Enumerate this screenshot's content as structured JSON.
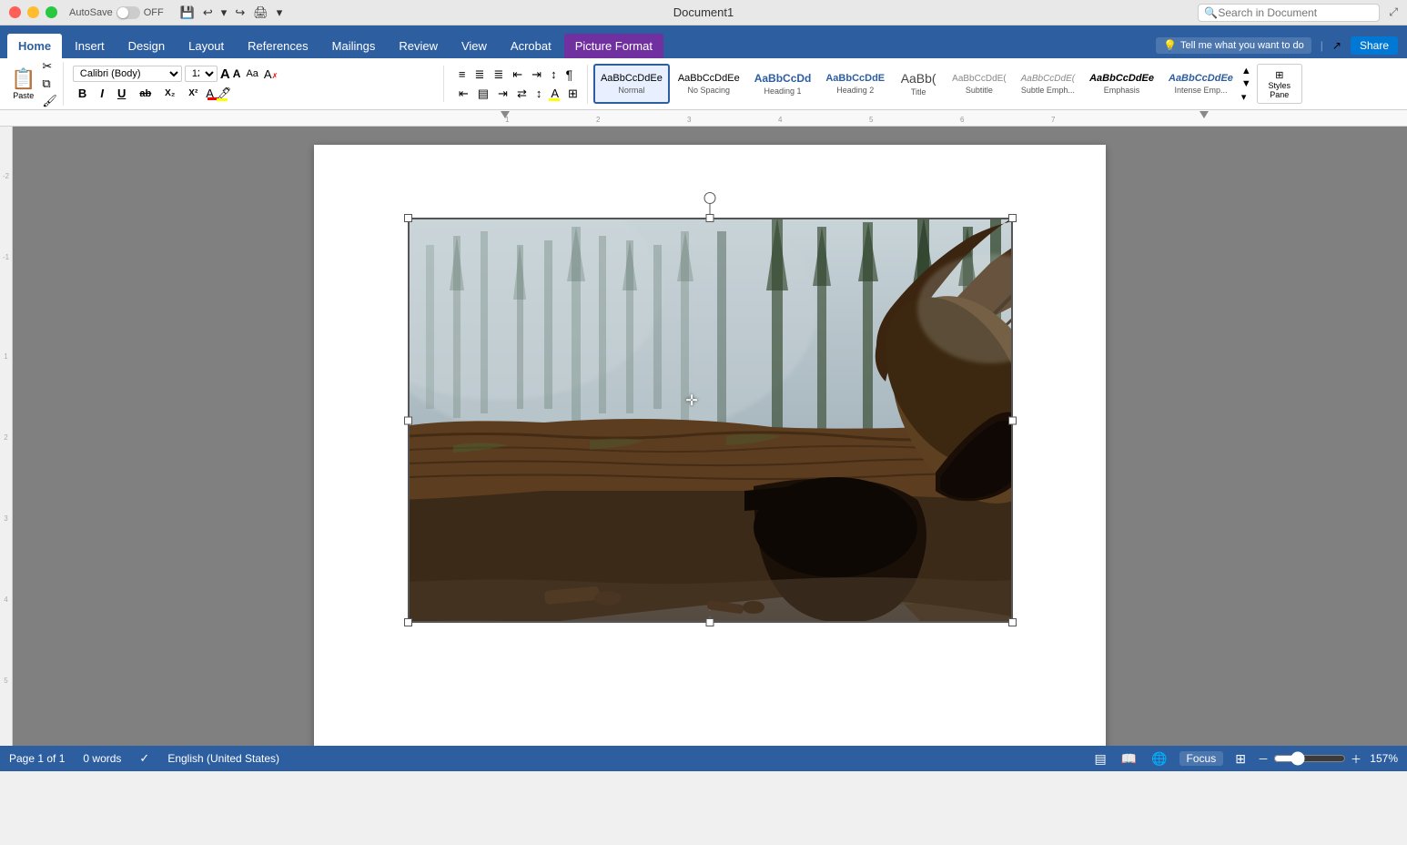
{
  "titleBar": {
    "title": "Document1",
    "autosave": "AutoSave",
    "autosave_off": "OFF",
    "search_placeholder": "Search in Document"
  },
  "ribbonTabs": {
    "tabs": [
      {
        "id": "home",
        "label": "Home",
        "active": true
      },
      {
        "id": "insert",
        "label": "Insert"
      },
      {
        "id": "design",
        "label": "Design"
      },
      {
        "id": "layout",
        "label": "Layout"
      },
      {
        "id": "references",
        "label": "References"
      },
      {
        "id": "mailings",
        "label": "Mailings"
      },
      {
        "id": "review",
        "label": "Review"
      },
      {
        "id": "view",
        "label": "View"
      },
      {
        "id": "acrobat",
        "label": "Acrobat"
      },
      {
        "id": "picture_format",
        "label": "Picture Format",
        "special": true
      }
    ],
    "tell_me": "Tell me what you want to do",
    "share": "Share"
  },
  "fontControls": {
    "font": "Calibri (Body)",
    "size": "12",
    "bold": "B",
    "italic": "I",
    "underline": "U",
    "strikethrough": "ab",
    "subscript": "X₂",
    "superscript": "X²",
    "increase_size": "A",
    "decrease_size": "A",
    "change_case": "Aa",
    "clear_format": "A"
  },
  "styles": [
    {
      "id": "normal",
      "label": "Normal",
      "preview": "AaBbCcDdEe",
      "active": true
    },
    {
      "id": "no_spacing",
      "label": "No Spacing",
      "preview": "AaBbCcDdEe"
    },
    {
      "id": "heading1",
      "label": "Heading 1",
      "preview": "AaBbCcDd"
    },
    {
      "id": "heading2",
      "label": "Heading 2",
      "preview": "AaBbCcDdE"
    },
    {
      "id": "title",
      "label": "Title",
      "preview": "AaBb("
    },
    {
      "id": "subtitle",
      "label": "Subtitle",
      "preview": "AaBbCcDdE("
    },
    {
      "id": "subtle_emph",
      "label": "Subtle Emph...",
      "preview": "AaBbCcDdE("
    },
    {
      "id": "emphasis",
      "label": "Emphasis",
      "preview": "AaBbCcDdEe"
    },
    {
      "id": "intense_emph",
      "label": "Intense Emp...",
      "preview": "AaBbCcDdEe"
    }
  ],
  "stylesPaneBtn": {
    "label": "Styles\nPane"
  },
  "toolbar": {
    "paste": "Paste",
    "cut_icon": "✂",
    "copy_icon": "⧉",
    "format_painter": "🖌"
  },
  "paragraph": {
    "bullets": "≡",
    "numbering": "≣",
    "multilevel": "≣",
    "decrease_indent": "←",
    "increase_indent": "→",
    "sort": "↕",
    "show_marks": "¶",
    "align_left": "≡",
    "align_center": "≡",
    "align_right": "≡",
    "align_justify": "≡",
    "line_spacing": "↕",
    "shading": "▓",
    "borders": "⊞"
  },
  "statusBar": {
    "page": "Page 1 of 1",
    "words": "0 words",
    "language": "English (United States)",
    "zoom": "157%"
  },
  "ruler": {
    "marks": [
      "1",
      "2",
      "3",
      "4",
      "5",
      "6",
      "7"
    ]
  },
  "leftMargin": {
    "marks": [
      "-2",
      "-1",
      "1",
      "2",
      "3",
      "4",
      "5"
    ]
  }
}
